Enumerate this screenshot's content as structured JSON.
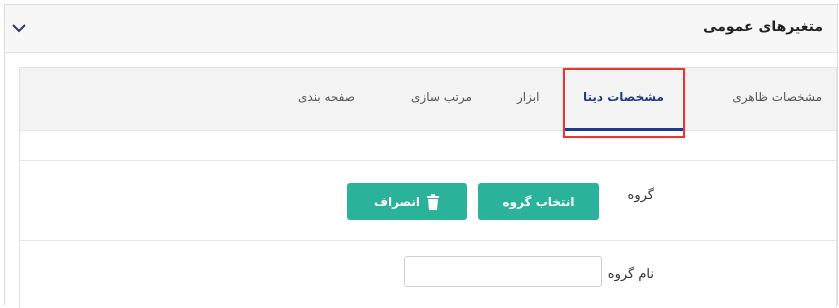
{
  "header": {
    "title": "متغیرهای عمومی",
    "collapse_icon": "chevron-down-icon"
  },
  "tabs": [
    {
      "label": "مشخصات ظاهری",
      "active": false
    },
    {
      "label": "مشخصات دیتا",
      "active": true
    },
    {
      "label": "ابزار",
      "active": false
    },
    {
      "label": "مرتب سازی",
      "active": false
    },
    {
      "label": "صفحه بندی",
      "active": false
    }
  ],
  "form": {
    "group_label": "گروه",
    "select_group_button": "انتخاب گروه",
    "cancel_button": "انصراف",
    "cancel_icon": "trash-icon",
    "group_name_label": "نام گروه",
    "group_name_value": ""
  },
  "colors": {
    "accent_teal": "#2ab29a",
    "active_tab": "#1f3a8a",
    "highlight_box": "#e53935"
  }
}
